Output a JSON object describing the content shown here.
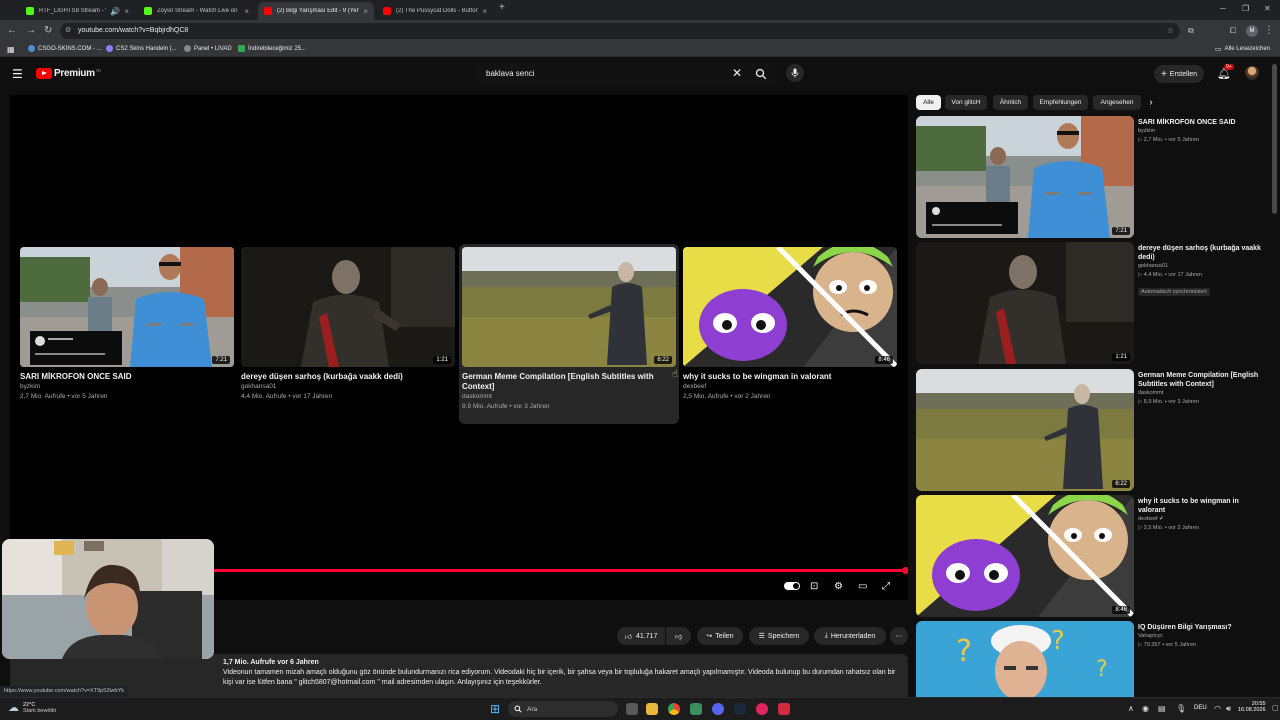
{
  "browser": {
    "tabs": [
      {
        "title": "RTF_LIGHTS8 Stream - Watc",
        "favicon_color": "#53fc18",
        "active": false
      },
      {
        "title": "Zoysn Stream - Watch Live on",
        "favicon_color": "#53fc18",
        "active": false
      },
      {
        "title": "(2) Bilgi Yarışması Edit - 9 (Yeni",
        "favicon_color": "#ff0000",
        "active": true
      },
      {
        "title": "(2) The Pussycat Dolls - Button",
        "favicon_color": "#ff0000",
        "active": false
      }
    ],
    "new_tab": "+",
    "url": "youtube.com/watch?v=BqbjrdhQC8",
    "bookmarks": [
      {
        "label": "CSGO-SKINS.COM - ...",
        "color": "#4a90d9"
      },
      {
        "label": "CS2 Skins Handeln (...",
        "color": "#8a7fff"
      },
      {
        "label": "Panel • LIVAD",
        "color": "#888888"
      },
      {
        "label": "İndirebileceğimiz 25...",
        "color": "#34a853"
      }
    ],
    "all_bookmarks": "Alle Lesezeichen",
    "profile_initial": "M"
  },
  "youtube": {
    "logo_text": "Premium",
    "logo_superscript": "TR",
    "search_value": "baklava senci",
    "create_label": "Erstellen",
    "notification_count": "9+"
  },
  "player": {
    "end_cards": [
      {
        "title": "SARI MİKROFON ONCE SAID",
        "channel": "byzkim",
        "meta": "2,7 Mio. Aufrufe • vor 5 Jahren",
        "duration": "7:21"
      },
      {
        "title": "dereye düşen sarhoş (kurbağa vaakk dedi)",
        "channel": "gokhansa01",
        "meta": "4,4 Mio. Aufrufe • vor 17 Jahren",
        "duration": "1:21"
      },
      {
        "title": "German Meme Compilation [English Subtitles with Context]",
        "channel": "daskommt",
        "meta": "8,9 Mio. Aufrufe • vor 3 Jahren",
        "duration": "6:22"
      },
      {
        "title": "why it sucks to be wingman in valorant",
        "channel": "dexbeef",
        "meta": "2,5 Mio. Aufrufe • vor 2 Jahren",
        "duration": "8:46"
      }
    ],
    "watched_fraction": 1.0
  },
  "actions": {
    "likes": "41.717",
    "share": "Teilen",
    "save": "Speichern",
    "download": "Herunterladen"
  },
  "description": {
    "stats": "1,7 Mio. Aufrufe  vor 6 Jahren",
    "text": "Videonun tamamen mizah amaçlı olduğunu göz önünde bulundurmanızı rica ediyorum. Videodaki hiç bir içerik, bir şahsa veya bir topluluğa hakaret amaçlı yapılmamıştır. Videoda bulunup bu durumdan rahatsız olan bir kişi var ise lütfen bana \" glitch5807@hotmail.com \" mail adresimden ulaşın. Anlayışınız için teşekkürler."
  },
  "sidebar": {
    "chips": [
      "Alle",
      "Von glitcH",
      "Ähnlich",
      "Empfehlungen",
      "Angesehen"
    ],
    "items": [
      {
        "title": "SARI MİKROFON ONCE SAID",
        "channel": "byzkim",
        "meta": "▷ 2,7 Mio. • vor 5 Jahren",
        "duration": "7:21",
        "badge": ""
      },
      {
        "title": "dereye düşen sarhoş (kurbağa vaakk dedi)",
        "channel": "gokhansa01",
        "meta": "▷ 4,4 Mio. • vor 17 Jahren",
        "duration": "1:21",
        "badge": "Automatisch synchronisiert"
      },
      {
        "title": "German Meme Compilation [English Subtitles with Context]",
        "channel": "daskommt",
        "meta": "▷ 8,9 Mio. • vor 3 Jahren",
        "duration": "6:22",
        "badge": ""
      },
      {
        "title": "why it sucks to be wingman in valorant",
        "channel": "dexbeef ✔",
        "meta": "▷ 2,5 Mio. • vor 2 Jahren",
        "duration": "8:46",
        "badge": ""
      },
      {
        "title": "IQ Düşüren Bilgi Yarışması?",
        "channel": "Vahapicyc",
        "meta": "▷ 79.367 • vor 5 Jahren",
        "duration": "",
        "badge": ""
      }
    ]
  },
  "status_url": "https://www.youtube.com/watch?v=XT9p52lwbYk",
  "taskbar": {
    "weather_temp": "22°C",
    "weather_desc": "Stark bewölkt",
    "search_placeholder": "Ara",
    "language": "DEU",
    "time": "20:55",
    "date": "16.08.2026"
  }
}
